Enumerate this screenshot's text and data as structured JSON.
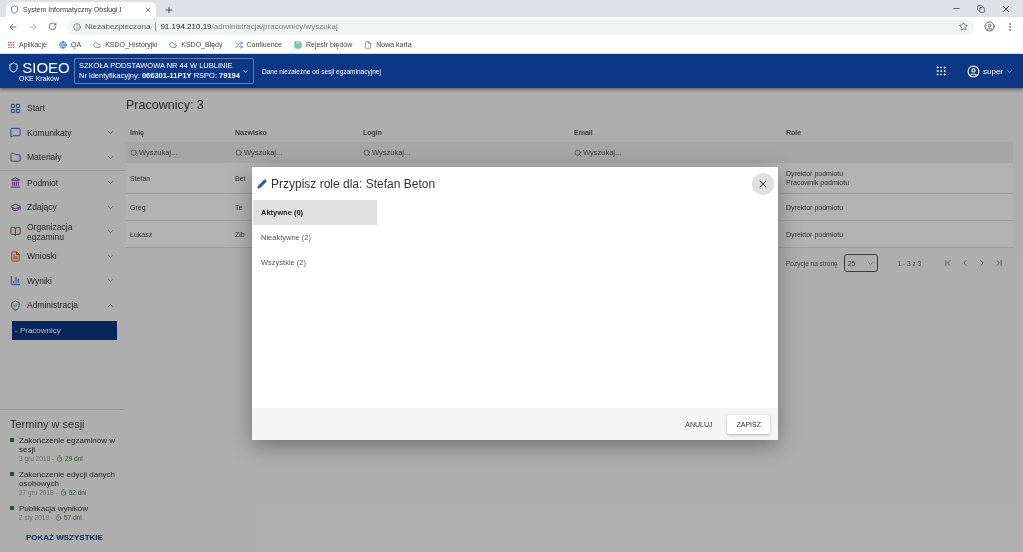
{
  "browser": {
    "tab_title": "System Informatyczny Obsługi I",
    "security": "Niezabezpieczona",
    "host": "91.194.210.19",
    "path": "/administracja/pracownicy/wyszukaj",
    "bookmarks": [
      "Aplikacje",
      "QA",
      "KSDO_Historyjki",
      "KSDO_Błędy",
      "Confluence",
      "Rejestr błędów",
      "Nowa karta"
    ]
  },
  "header": {
    "logo": "SIOEO",
    "logo_sub": "OKE Kraków",
    "school_name": "SZKOŁA PODSTAWOWA NR 44 W LUBLINIE",
    "school_ids": "Nr identyfikacyjny: **066301-11P1Y** RSPO: **79194**",
    "note": "Dane niezależne od sesji egzaminacyjnej",
    "user": "super"
  },
  "sidebar": {
    "items": [
      {
        "label": "Start"
      },
      {
        "label": "Komunikaty",
        "expanded": false
      },
      {
        "label": "Materiały",
        "expanded": false
      },
      {
        "label": "Podmiot",
        "expanded": false
      },
      {
        "label": "Zdający",
        "expanded": false
      },
      {
        "label": "Organizacja egzaminu",
        "expanded": false
      },
      {
        "label": "Wnioski",
        "expanded": false
      },
      {
        "label": "Wyniki",
        "expanded": false
      },
      {
        "label": "Administracja",
        "expanded": true,
        "children": [
          {
            "label": "- Pracownicy",
            "selected": true
          }
        ]
      }
    ],
    "deadlines": {
      "title": "Terminy w sesji",
      "items": [
        {
          "title": "Zakończenie egzaminów w sesji",
          "date": "3 gru 2018 -",
          "remaining": "29 dni"
        },
        {
          "title": "Zakończenie edycji danych osobowych",
          "date": "27 gru 2018 -",
          "remaining": "52 dni"
        },
        {
          "title": "Publikacja wyników",
          "date": "2 sty 2019 -",
          "remaining": "57 dni"
        }
      ],
      "link": "POKAŻ WSZYSTKIE"
    }
  },
  "main": {
    "title": "Pracownicy: 3",
    "columns": [
      "Imię",
      "Nazwisko",
      "Login",
      "Email",
      "Role"
    ],
    "search_placeholders": [
      "Wyszukaj...",
      "Wyszukaj...",
      "Wyszukaj...",
      "Wyszukaj..."
    ],
    "rows": [
      {
        "first_name": "Stefan",
        "last_name": "Bet",
        "roles": [
          "Dyrektor podmiotu",
          "Pracownik podmiotu"
        ]
      },
      {
        "first_name": "Greg",
        "last_name": "Te",
        "roles": [
          "Dyrektor podmiotu"
        ]
      },
      {
        "first_name": "Łukasz",
        "last_name": "Zib",
        "roles": [
          "Dyrektor podmiotu"
        ]
      }
    ],
    "pagination": {
      "label": "Pozycje na stronę",
      "per_page": "25",
      "range": "1 - 3 z 3"
    }
  },
  "dialog": {
    "title": "Przypisz role dla: Stefan Beton",
    "tabs": [
      {
        "label": "Aktywne (0)",
        "selected": true
      },
      {
        "label": "Nieaktywne (2)",
        "selected": false
      },
      {
        "label": "Wszystkie (2)",
        "selected": false
      }
    ],
    "buttons": [
      {
        "label": "ANULUJ",
        "kind": "text"
      },
      {
        "label": "ZAPISZ",
        "kind": "raised"
      }
    ]
  }
}
